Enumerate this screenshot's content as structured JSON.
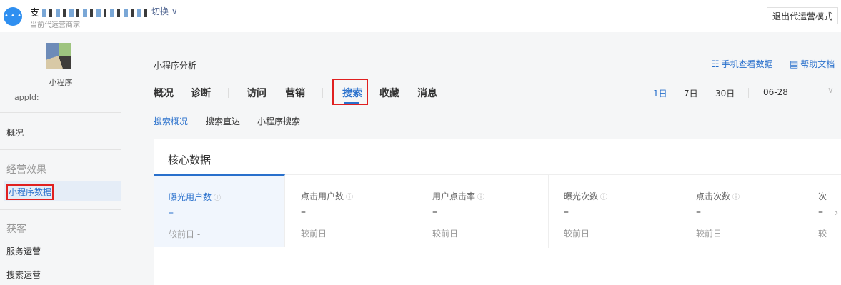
{
  "topbar": {
    "avatar_label": "• • •",
    "merchant_name_prefix": "支",
    "switch_label": "切换 ∨",
    "merchant_sub": "当前代运营商家",
    "exit_label": "退出代运营模式"
  },
  "sidebar": {
    "app_name": "小程序",
    "app_id": "appId:",
    "items": {
      "overview": "概况",
      "group_effect": "经营效果",
      "miniprogram_data": "小程序数据",
      "group_acquire": "获客",
      "service_ops": "服务运营",
      "search_ops": "搜索运营"
    }
  },
  "main": {
    "page_title": "小程序分析",
    "mobile_data_link": "手机查看数据",
    "help_link": "帮助文档",
    "tabs": [
      "概况",
      "诊断",
      "访问",
      "营销",
      "搜索",
      "收藏",
      "消息"
    ],
    "active_tab": "搜索",
    "ranges": [
      "1日",
      "7日",
      "30日"
    ],
    "date": "06-28",
    "subtabs": [
      "搜索概况",
      "搜索直达",
      "小程序搜索"
    ],
    "card_title": "核心数据",
    "metrics": [
      {
        "label": "曝光用户数",
        "value": "–",
        "compare": "较前日 -"
      },
      {
        "label": "点击用户数",
        "value": "–",
        "compare": "较前日 -"
      },
      {
        "label": "用户点击率",
        "value": "–",
        "compare": "较前日 -"
      },
      {
        "label": "曝光次数",
        "value": "–",
        "compare": "较前日 -"
      },
      {
        "label": "点击次数",
        "value": "–",
        "compare": "较前日 -"
      },
      {
        "label": "次",
        "value": "–",
        "compare": "较"
      }
    ]
  },
  "colors": {
    "accent": "#2970cc",
    "highlight_box": "#e02020"
  },
  "icons": {
    "qr": "qr-code-icon",
    "doc": "document-icon",
    "info": "info-icon",
    "chevron": "chevron-down-icon"
  }
}
